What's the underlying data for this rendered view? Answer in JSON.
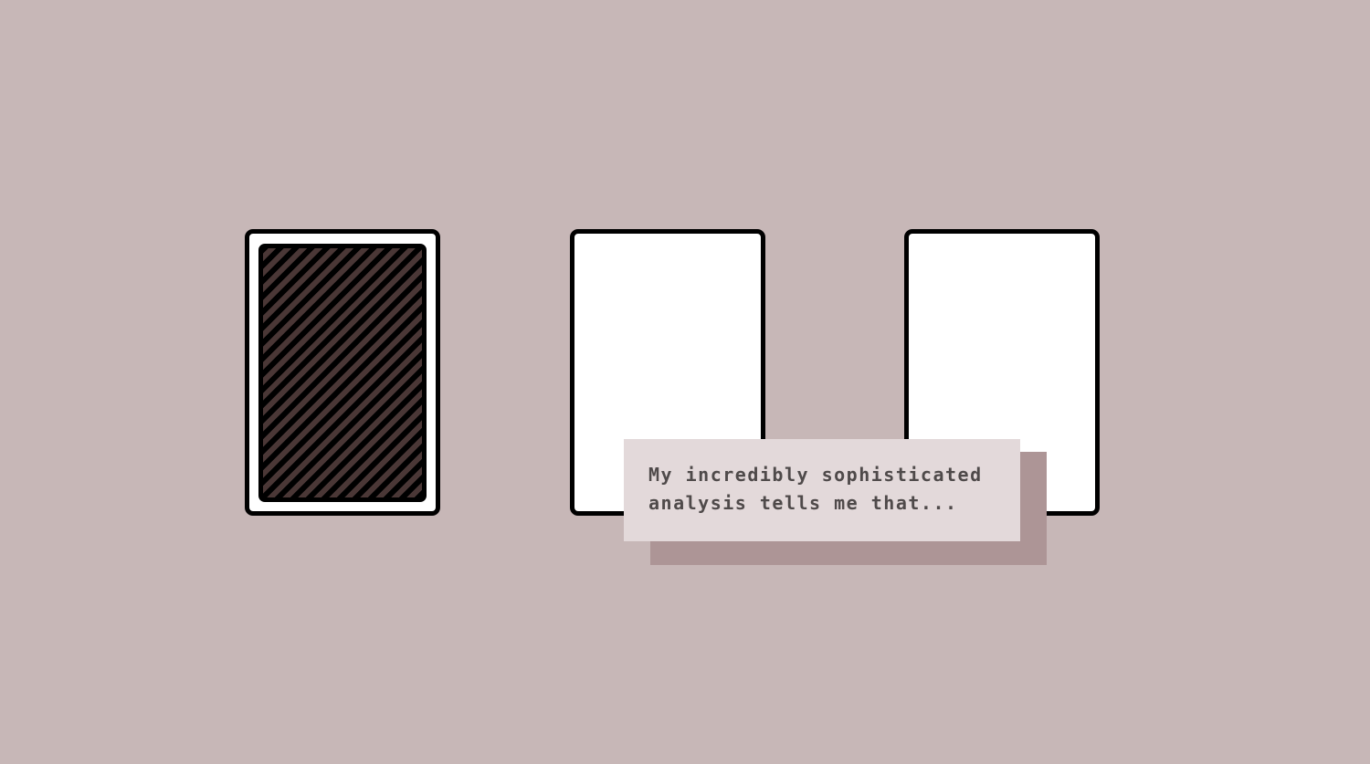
{
  "dialog": {
    "lines": [
      "My incredibly sophisticated",
      "analysis tells me that..."
    ]
  },
  "cards": [
    {
      "face": "back",
      "pattern": "diagonal-stripes"
    },
    {
      "face": "blank"
    },
    {
      "face": "blank"
    }
  ],
  "colors": {
    "background": "#c7b7b7",
    "card_face": "#ffffff",
    "card_border": "#000000",
    "card_back_stripe": "#4a3736",
    "dialog_background": "#e3d9da",
    "dialog_shadow": "#ad9596",
    "dialog_text": "#4f4a4a"
  }
}
